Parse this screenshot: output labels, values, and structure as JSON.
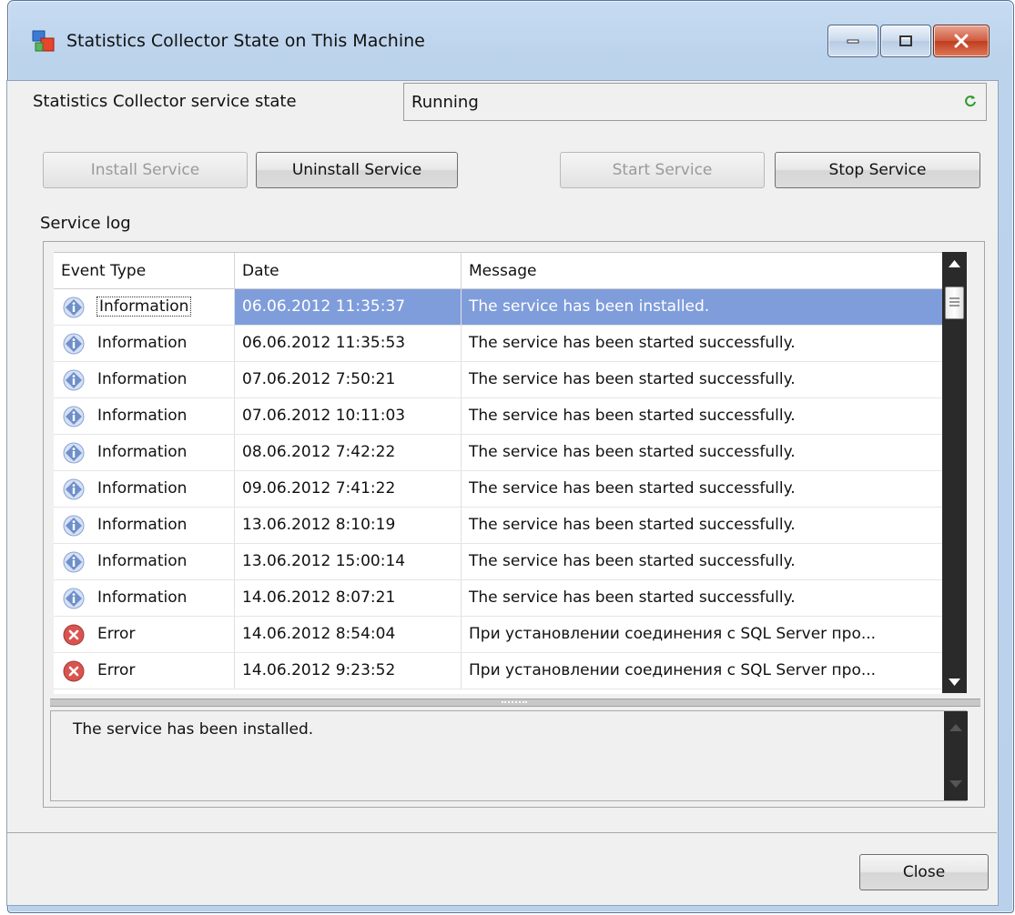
{
  "window": {
    "title": "Statistics Collector State on This Machine"
  },
  "service_state": {
    "label": "Statistics Collector service state",
    "value": "Running"
  },
  "buttons": {
    "install": "Install Service",
    "uninstall": "Uninstall Service",
    "start": "Start Service",
    "stop": "Stop Service",
    "close": "Close"
  },
  "log": {
    "label": "Service log",
    "columns": [
      "Event Type",
      "Date",
      "Message"
    ],
    "rows": [
      {
        "type": "Information",
        "icon": "info-icon",
        "date": "06.06.2012 11:35:37",
        "message": "The service has been installed.",
        "selected": true
      },
      {
        "type": "Information",
        "icon": "info-icon",
        "date": "06.06.2012 11:35:53",
        "message": "The service has been started successfully."
      },
      {
        "type": "Information",
        "icon": "info-icon",
        "date": "07.06.2012 7:50:21",
        "message": "The service has been started successfully."
      },
      {
        "type": "Information",
        "icon": "info-icon",
        "date": "07.06.2012 10:11:03",
        "message": "The service has been started successfully."
      },
      {
        "type": "Information",
        "icon": "info-icon",
        "date": "08.06.2012 7:42:22",
        "message": "The service has been started successfully."
      },
      {
        "type": "Information",
        "icon": "info-icon",
        "date": "09.06.2012 7:41:22",
        "message": "The service has been started successfully."
      },
      {
        "type": "Information",
        "icon": "info-icon",
        "date": "13.06.2012 8:10:19",
        "message": "The service has been started successfully."
      },
      {
        "type": "Information",
        "icon": "info-icon",
        "date": "13.06.2012 15:00:14",
        "message": "The service has been started successfully."
      },
      {
        "type": "Information",
        "icon": "info-icon",
        "date": "14.06.2012 8:07:21",
        "message": "The service has been started successfully."
      },
      {
        "type": "Error",
        "icon": "error-icon",
        "date": "14.06.2012 8:54:04",
        "message": "При установлении соединения с SQL Server про..."
      },
      {
        "type": "Error",
        "icon": "error-icon",
        "date": "14.06.2012 9:23:52",
        "message": "При установлении соединения с SQL Server про..."
      }
    ],
    "detail": "The service has been installed."
  },
  "colors": {
    "selection": "#7f9ddb",
    "info": "#6f8fc9",
    "error": "#d9534f",
    "running": "#2e9a2e"
  }
}
